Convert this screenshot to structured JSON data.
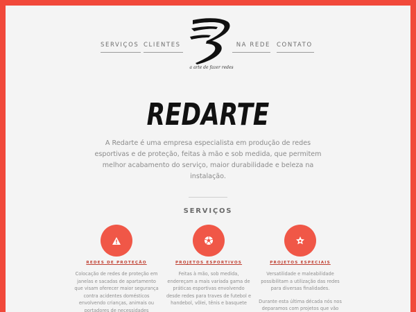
{
  "nav": {
    "items": [
      {
        "label": "SERVIÇOS"
      },
      {
        "label": "CLIENTES"
      },
      {
        "label": "NA REDE"
      },
      {
        "label": "CONTATO"
      }
    ]
  },
  "logo": {
    "tagline": "a arte de fazer redes"
  },
  "hero": {
    "title": "REDARTE",
    "intro": "A Redarte é uma empresa especialista em produção de redes esportivas e de proteção, feitas à mão e sob medida, que permitem melhor acabamento do serviço, maior durabilidade e beleza na instalação."
  },
  "section": {
    "title": "SERVIÇOS"
  },
  "services": [
    {
      "icon": "warning-icon",
      "title": "REDES DE PROTEÇÃO",
      "text": "Colocação de redes de proteção em janelas e sacadas de apartamento que visam oferecer maior segurança contra acidentes domésticos envolvendo crianças, animais ou portadores de necessidades especiais"
    },
    {
      "icon": "soccer-ball-icon",
      "title": "PROJETOS ESPORTIVOS",
      "text": "Feitas à mão, sob medida, endereçam a mais variada gama de práticas esportivas envolvendo desde redes para traves de futebol e handebol, vôlei, tênis e basquete"
    },
    {
      "icon": "star-icon",
      "title": "PROJETOS ESPECIAIS",
      "text": "Versatilidade e maleabilidade possibilitam a utilização das redes para diversas finalidades.",
      "text2": "Durante esta última década nós nos deparamos com projetos que vão"
    }
  ],
  "colors": {
    "accent": "#f1493a",
    "circle": "#f05747",
    "background": "#f4f4f4"
  }
}
